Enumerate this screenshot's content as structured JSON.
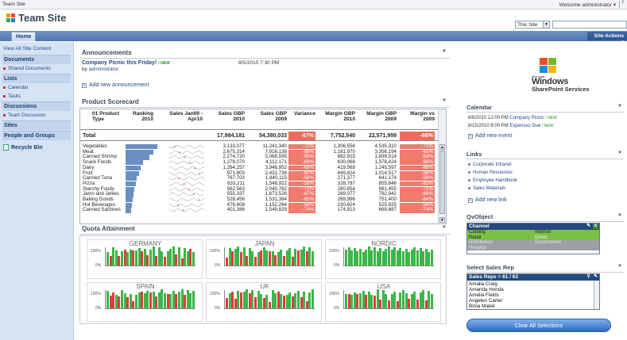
{
  "topbar": {
    "site_name": "Team Site",
    "welcome": "Welcome administrator ▾"
  },
  "header": {
    "title": "Team Site",
    "scope": "This Site"
  },
  "nav": {
    "home_tab": "Home",
    "site_actions": "Site Actions ▾"
  },
  "leftnav": {
    "view_all": "View All Site Content",
    "documents": "Documents",
    "shared_documents": "Shared Documents",
    "lists": "Lists",
    "calendar": "Calendar",
    "tasks": "Tasks",
    "discussions": "Discussions",
    "team_discussion": "Team Discussion",
    "sites": "Sites",
    "people_groups": "People and Groups",
    "recycle_bin": "Recycle Bin"
  },
  "announcements": {
    "title": "Announcements",
    "item_title": "Company Picnic this Friday!",
    "new_badge": "! NEW",
    "by_label": "by",
    "by_name": "administrator",
    "date": "8/5/2010 7:30 PM",
    "add_label": "Add new announcement"
  },
  "scorecard": {
    "title": "Product Scorecard",
    "headers": {
      "type": "01 Product Type",
      "ranking": "Ranking 2010",
      "sales": "Sales Jan09 - Apr10",
      "sales_gbp_2010": "Sales GBP 2010",
      "sales_gbp_2009": "Sales GBP 2009",
      "variance": "Variance",
      "margin_gbp_2010": "Margin GBP 2010",
      "margin_gbp_2009": "Margin GBP 2009",
      "margin_vs": "Margin vs 2009"
    },
    "total": {
      "label": "Total",
      "s2010": "17,984,181",
      "s2009": "54,380,033",
      "variance": "-67%",
      "m2010": "7,752,540",
      "m2009": "22,571,959",
      "mvs": "-66%"
    },
    "rows": [
      {
        "name": "Vegetables",
        "rank": 1.0,
        "s2010": "3,133,077",
        "s2009": "11,241,340",
        "var": "-72%",
        "m2010": "1,306,558",
        "m2009": "4,535,310",
        "mvs": "-71%"
      },
      {
        "name": "Meat",
        "rank": 0.88,
        "s2010": "2,675,314",
        "s2009": "7,916,138",
        "var": "-66%",
        "m2010": "1,181,970",
        "m2009": "3,356,194",
        "mvs": "-65%"
      },
      {
        "name": "Canned Shrimp",
        "rank": 0.74,
        "s2010": "2,274,720",
        "s2009": "5,068,595",
        "var": "-55%",
        "m2010": "882,915",
        "m2009": "1,899,514",
        "mvs": "-54%"
      },
      {
        "name": "Snack Foods",
        "rank": 0.56,
        "s2010": "1,278,070",
        "s2009": "4,112,171",
        "var": "-69%",
        "m2010": "630,066",
        "m2009": "1,978,424",
        "mvs": "-68%"
      },
      {
        "name": "Dairy",
        "rank": 0.48,
        "s2010": "1,264,257",
        "s2009": "3,948,952",
        "var": "-68%",
        "m2010": "419,569",
        "m2009": "1,245,597",
        "mvs": "-66%"
      },
      {
        "name": "Fruit",
        "rank": 0.42,
        "s2010": "971,803",
        "s2009": "2,431,738",
        "var": "-60%",
        "m2010": "449,824",
        "m2009": "1,014,517",
        "mvs": "-56%"
      },
      {
        "name": "Canned Tuna",
        "rank": 0.36,
        "s2010": "767,703",
        "s2009": "1,840,115",
        "var": "-58%",
        "m2010": "271,377",
        "m2009": "641,174",
        "mvs": "-58%"
      },
      {
        "name": "Pizza",
        "rank": 0.32,
        "s2010": "633,211",
        "s2009": "1,548,922",
        "var": "-59%",
        "m2010": "328,787",
        "m2009": "855,846",
        "mvs": "-62%"
      },
      {
        "name": "Starchy Foods",
        "rank": 0.28,
        "s2010": "562,563",
        "s2009": "2,040,782",
        "var": "-72%",
        "m2010": "280,854",
        "m2009": "981,455",
        "mvs": "-71%"
      },
      {
        "name": "Jams and Jellies",
        "rank": 0.25,
        "s2010": "555,337",
        "s2009": "1,673,526",
        "var": "-67%",
        "m2010": "269,077",
        "m2009": "782,942",
        "mvs": "-66%"
      },
      {
        "name": "Baking Goods",
        "rank": 0.22,
        "s2010": "528,456",
        "s2009": "1,531,384",
        "var": "-65%",
        "m2010": "269,996",
        "m2009": "751,400",
        "mvs": "-64%"
      },
      {
        "name": "Hot Beverages",
        "rank": 0.2,
        "s2010": "478,608",
        "s2009": "1,152,264",
        "var": "-58%",
        "m2010": "230,624",
        "m2009": "525,925",
        "mvs": "-56%"
      },
      {
        "name": "Canned Sardines",
        "rank": 0.18,
        "s2010": "401,386",
        "s2009": "1,549,829",
        "var": "-74%",
        "m2010": "174,913",
        "m2009": "669,687",
        "mvs": "-74%"
      }
    ]
  },
  "quota": {
    "title": "Quota Attainment",
    "axis_100": "100%",
    "axis_0": "0%",
    "regions": [
      {
        "name": "GERMANY",
        "pattern": [
          1,
          0,
          1,
          1,
          0,
          1,
          0,
          1,
          1,
          0,
          1,
          1,
          0,
          1,
          0,
          1,
          1,
          0,
          1,
          1,
          0,
          1,
          1,
          1,
          0,
          1,
          0,
          1,
          1,
          0,
          1
        ]
      },
      {
        "name": "JAPAN",
        "pattern": [
          0,
          1,
          0,
          1,
          1,
          0,
          1,
          0,
          1,
          1,
          0,
          1,
          0,
          1,
          1,
          0,
          1,
          0,
          1,
          1,
          0,
          1,
          1,
          0,
          1,
          0,
          1,
          1,
          0,
          1,
          1
        ]
      },
      {
        "name": "NORDIC",
        "pattern": [
          1,
          1,
          1,
          1,
          1,
          1,
          1,
          1,
          1,
          1,
          1,
          1,
          1,
          1,
          1,
          1,
          1,
          1,
          1,
          1,
          1,
          1,
          1,
          1,
          1,
          1,
          1,
          1,
          1,
          1,
          1
        ]
      },
      {
        "name": "SPAIN",
        "pattern": [
          1,
          0,
          0,
          1,
          0,
          1,
          1,
          0,
          1,
          0,
          1,
          1,
          0,
          1,
          1,
          0,
          1,
          0,
          1,
          1,
          1,
          0,
          1,
          1,
          0,
          1,
          1,
          0,
          1,
          1,
          1
        ]
      },
      {
        "name": "UK",
        "pattern": [
          0,
          1,
          0,
          0,
          1,
          0,
          1,
          1,
          0,
          1,
          0,
          1,
          1,
          0,
          1,
          0,
          1,
          1,
          0,
          1,
          0,
          1,
          1,
          0,
          1,
          1,
          0,
          1,
          0,
          1,
          1
        ]
      },
      {
        "name": "USA",
        "pattern": [
          1,
          0,
          1,
          1,
          0,
          1,
          1,
          0,
          1,
          1,
          0,
          1,
          0,
          1,
          1,
          0,
          1,
          1,
          0,
          1,
          1,
          1,
          0,
          1,
          1,
          0,
          1,
          1,
          0,
          1,
          1
        ]
      }
    ]
  },
  "brand": {
    "small": "Microsoft",
    "big": "Windows",
    "sub": "SharePoint Services"
  },
  "calendar": {
    "title": "Calendar",
    "events": [
      {
        "date": "8/6/2010 12:00 PM",
        "name": "Company Picnic",
        "new": "! NEW"
      },
      {
        "date": "8/15/2010 8:00 PM",
        "name": "Expenses Due",
        "new": "! NEW"
      }
    ],
    "add_label": "Add new event"
  },
  "links": {
    "title": "Links",
    "items": [
      "Corporate Intranet",
      "Human Resources",
      "Employee Handbook",
      "Sales Materials"
    ],
    "add_label": "Add new link"
  },
  "qvobject": {
    "title": "QvObject",
    "list_title": "Channel",
    "cells": [
      "Catalog",
      "Internet",
      "Retail",
      "Direct",
      "Distribution",
      "Government",
      "Hospital"
    ]
  },
  "sales_rep": {
    "title": "Select Sales Rep",
    "list_title": "Sales Reps = 61 / 63",
    "items": [
      "Amalia Craig",
      "Amanda Honda",
      "Amelia Fields",
      "Angelen Carter",
      "Bima Malek"
    ]
  },
  "clear_button": "Clear All Selections",
  "colors": {
    "accent": "#24497f",
    "negative": "#ef6a5d",
    "good": "#3cb54a",
    "bad": "#e03c3c",
    "selected": "#7bc043"
  }
}
